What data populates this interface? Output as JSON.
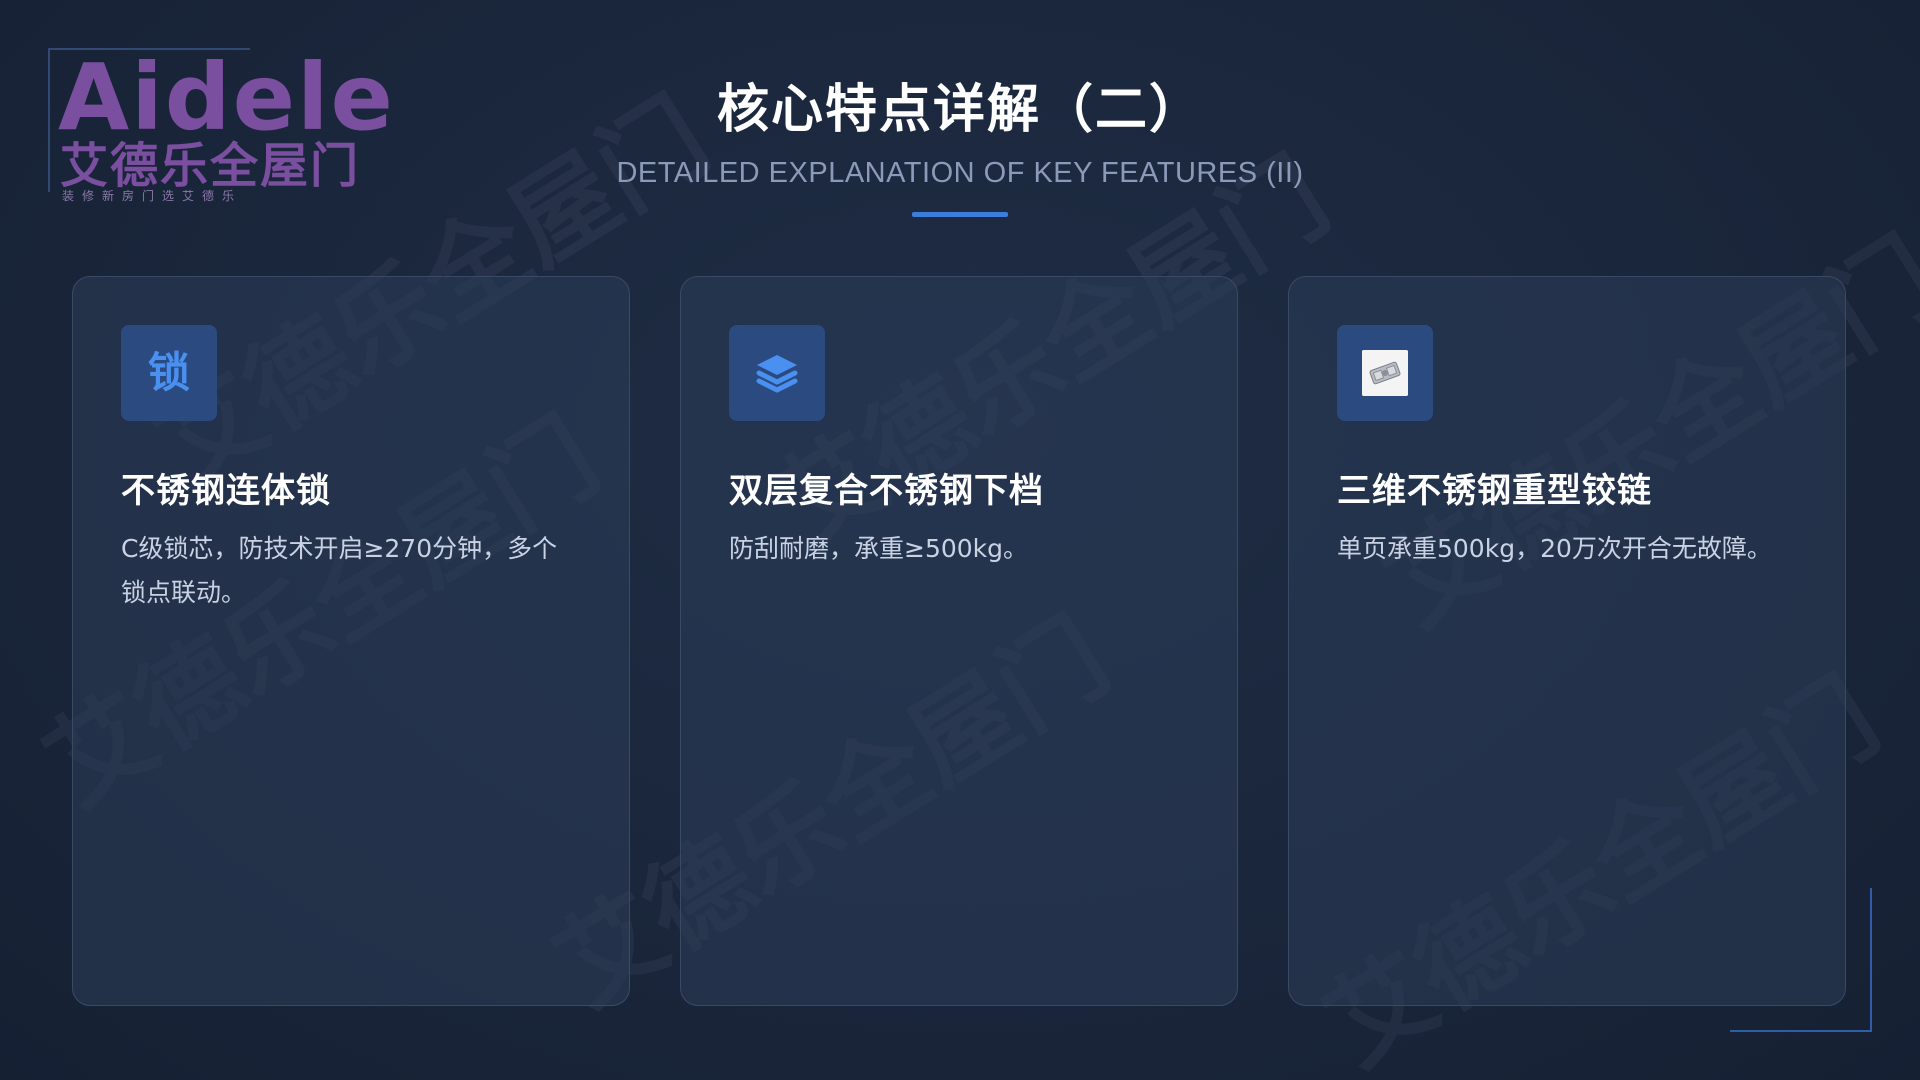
{
  "logo": {
    "wordmark": "Aidele",
    "name_cn": "艾德乐全屋门",
    "slogan": "装修新房门选艾德乐"
  },
  "header": {
    "title": "核心特点详解（二）",
    "subtitle": "DETAILED EXPLANATION OF KEY FEATURES (II)"
  },
  "cards": [
    {
      "icon_name": "lock-char-icon",
      "icon_text": "锁",
      "title": "不锈钢连体锁",
      "description": "C级锁芯，防技术开启≥270分钟，多个锁点联动。"
    },
    {
      "icon_name": "layers-icon",
      "title": "双层复合不锈钢下档",
      "description": "防刮耐磨，承重≥500kg。"
    },
    {
      "icon_name": "hinge-image-icon",
      "title": "三维不锈钢重型铰链",
      "description": "单页承重500kg，20万次开合无故障。"
    }
  ],
  "watermark_text": "艾德乐全屋门",
  "colors": {
    "background": "#1a263b",
    "accent": "#3b7ddd",
    "logo": "#7b4fa0",
    "icon_box": "#2a4a80",
    "icon": "#4a90f0"
  }
}
